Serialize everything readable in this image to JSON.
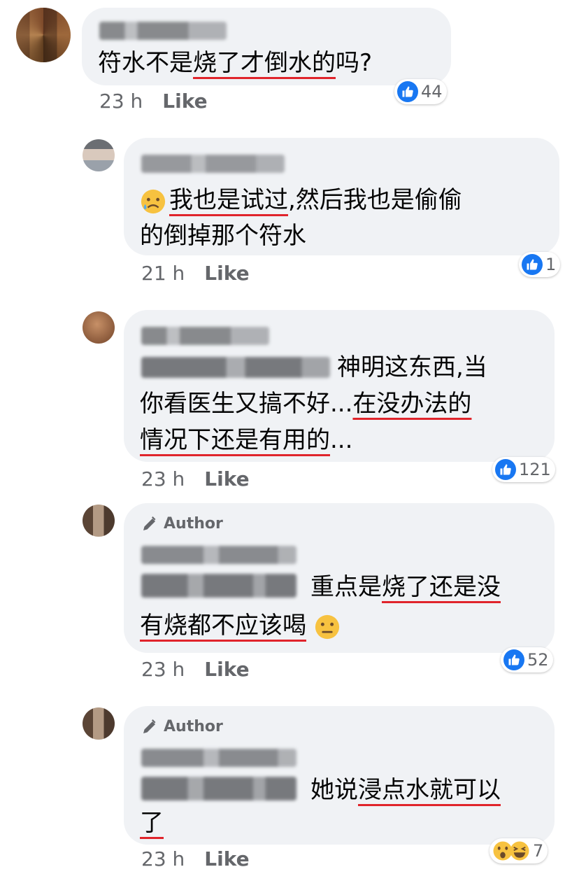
{
  "comments": [
    {
      "author": "Lee Man Hoi",
      "text_parts": [
        {
          "t": "符水不是",
          "u": false
        },
        {
          "t": "烧了才倒水的",
          "u": true
        },
        {
          "t": "吗?",
          "u": false
        }
      ],
      "time": "23 h",
      "like_label": "Like",
      "reaction_count": "44"
    },
    {
      "author": "Tomfey Hong",
      "line1_parts": [
        {
          "t": "我也是试过",
          "u": true
        },
        {
          "t": ",然后我也是偷偷",
          "u": false
        }
      ],
      "line2": "的倒掉那个符水",
      "time": "21 h",
      "like_label": "Like",
      "reaction_count": "1"
    },
    {
      "author": "Lee Man Hoi",
      "tag": "Charlotte Tung",
      "line1": "神明这东西,当",
      "line2_a": "你看医生又搞不好...",
      "line2_b": "在没办法的",
      "line3_a": "情况下还是有用的",
      "line3_b": "...",
      "time": "23 h",
      "like_label": "Like",
      "reaction_count": "121"
    },
    {
      "badge": "Author",
      "author": "Charlotte Tung",
      "tag": "Lee Man Hoi",
      "line1_a": "重点是",
      "line1_b": "烧了还是没",
      "line2": "有烧都不应该喝",
      "time": "23 h",
      "like_label": "Like",
      "reaction_count": "52"
    },
    {
      "badge": "Author",
      "author": "Charlotte Tung",
      "tag": "Lee Man Hoi",
      "line1_a": "她说",
      "line1_b": "浸点水就可以",
      "line2": "了",
      "time": "23 h",
      "like_label": "Like",
      "reaction_count": "7"
    }
  ],
  "colors": {
    "bubble": "#f0f2f5",
    "underline": "#e0242b",
    "like_blue": "#1877f2",
    "meta": "#65676b"
  }
}
